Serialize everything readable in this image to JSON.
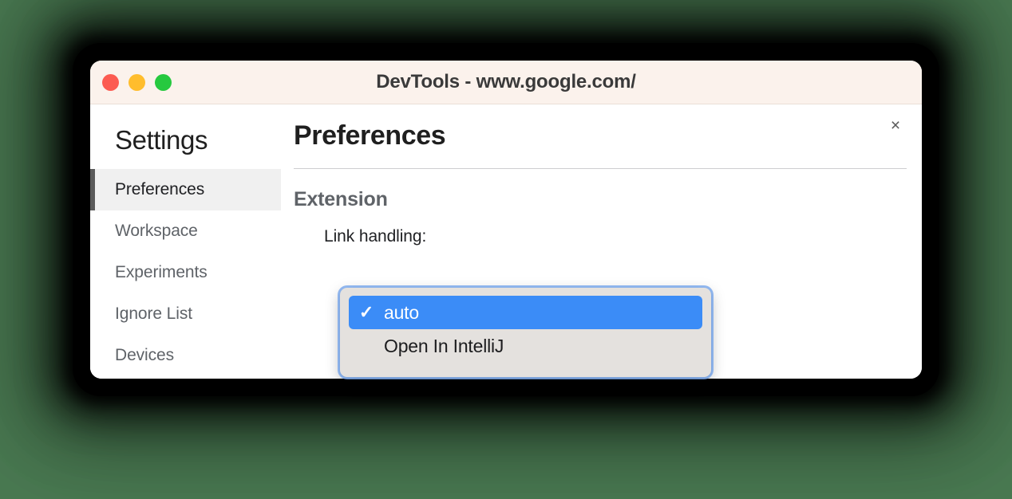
{
  "window": {
    "title": "DevTools - www.google.com/",
    "traffic_lights": [
      {
        "name": "close",
        "color": "#fc5b51"
      },
      {
        "name": "minimize",
        "color": "#ffbd2d"
      },
      {
        "name": "zoom",
        "color": "#26c93f"
      }
    ],
    "close_icon": "×"
  },
  "sidebar": {
    "title": "Settings",
    "items": [
      {
        "label": "Preferences",
        "selected": true
      },
      {
        "label": "Workspace",
        "selected": false
      },
      {
        "label": "Experiments",
        "selected": false
      },
      {
        "label": "Ignore List",
        "selected": false
      },
      {
        "label": "Devices",
        "selected": false
      }
    ]
  },
  "main": {
    "page_title": "Preferences",
    "section_title": "Extension",
    "field": {
      "label": "Link handling:",
      "value": "auto"
    }
  },
  "dropdown": {
    "open": true,
    "check_glyph": "✓",
    "options": [
      {
        "label": "auto",
        "selected": true
      },
      {
        "label": "Open In IntelliJ",
        "selected": false
      }
    ]
  },
  "colors": {
    "desktop_background": "#4a7a52",
    "titlebar_background": "#fbf2ec",
    "selected_nav_background": "#f0f0f0",
    "selected_nav_border": "#5a5a5a",
    "highlight_blue": "#3b8cf7",
    "popup_background": "#e4e1de"
  }
}
